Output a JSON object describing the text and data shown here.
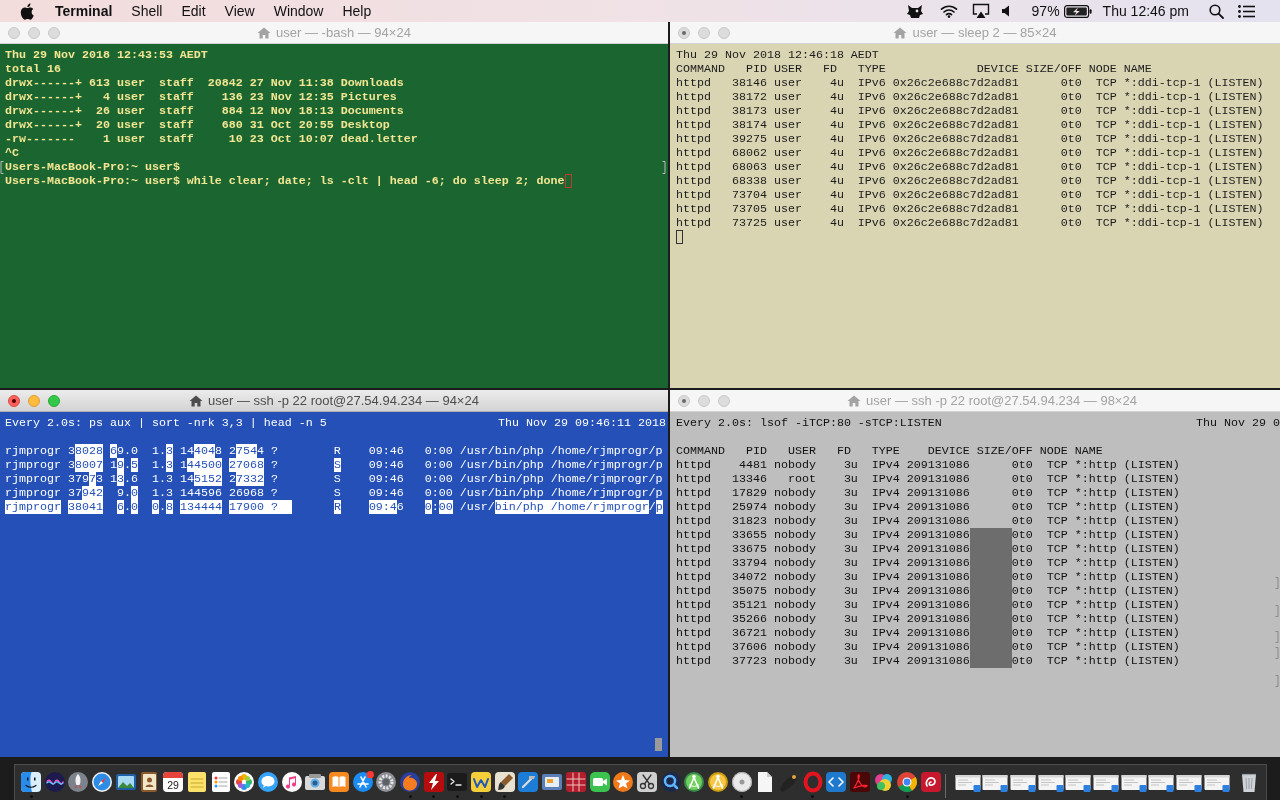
{
  "menu_bar": {
    "app_name": "Terminal",
    "menus": [
      "Shell",
      "Edit",
      "View",
      "Window",
      "Help"
    ],
    "battery_percent": "97%",
    "clock": "Thu 12:46 pm"
  },
  "windows": [
    {
      "kind": "grass",
      "title": "user — -bash — 94×24",
      "active": false,
      "busy": false,
      "cursor": true,
      "lines": [
        {
          "text": "Thu 29 Nov 2018 12:43:53 AEDT",
          "marked": false
        },
        {
          "text": "total 16",
          "marked": false
        },
        {
          "text": "drwx------+ 613 user  staff  20842 27 Nov 11:38 Downloads",
          "marked": false
        },
        {
          "text": "drwx------+   4 user  staff    136 23 Nov 12:35 Pictures",
          "marked": false
        },
        {
          "text": "drwx------+  26 user  staff    884 12 Nov 18:13 Documents",
          "marked": false
        },
        {
          "text": "drwx------+  20 user  staff    680 31 Oct 20:55 Desktop",
          "marked": false
        },
        {
          "text": "-rw-------    1 user  staff     10 23 Oct 10:07 dead.letter",
          "marked": false
        },
        {
          "text": "^C",
          "marked": false
        },
        {
          "text": "Users-MacBook-Pro:~ user$",
          "marked": true
        },
        {
          "text": "Users-MacBook-Pro:~ user$ while clear; date; ls -clt | head -6; do sleep 2; done",
          "marked": false
        }
      ]
    },
    {
      "kind": "novel",
      "title": "user — sleep 2 — 85×24",
      "active": false,
      "busy": true,
      "cursor": true,
      "lines": [
        {
          "text": "Thu 29 Nov 2018 12:46:18 AEDT"
        },
        {
          "text": "COMMAND   PID USER   FD   TYPE             DEVICE SIZE/OFF NODE NAME"
        },
        {
          "text": "httpd   38146 user    4u  IPv6 0x26c2e688c7d2ad81      0t0  TCP *:ddi-tcp-1 (LISTEN)"
        },
        {
          "text": "httpd   38172 user    4u  IPv6 0x26c2e688c7d2ad81      0t0  TCP *:ddi-tcp-1 (LISTEN)"
        },
        {
          "text": "httpd   38173 user    4u  IPv6 0x26c2e688c7d2ad81      0t0  TCP *:ddi-tcp-1 (LISTEN)"
        },
        {
          "text": "httpd   38174 user    4u  IPv6 0x26c2e688c7d2ad81      0t0  TCP *:ddi-tcp-1 (LISTEN)"
        },
        {
          "text": "httpd   39275 user    4u  IPv6 0x26c2e688c7d2ad81      0t0  TCP *:ddi-tcp-1 (LISTEN)"
        },
        {
          "text": "httpd   68062 user    4u  IPv6 0x26c2e688c7d2ad81      0t0  TCP *:ddi-tcp-1 (LISTEN)"
        },
        {
          "text": "httpd   68063 user    4u  IPv6 0x26c2e688c7d2ad81      0t0  TCP *:ddi-tcp-1 (LISTEN)"
        },
        {
          "text": "httpd   68338 user    4u  IPv6 0x26c2e688c7d2ad81      0t0  TCP *:ddi-tcp-1 (LISTEN)"
        },
        {
          "text": "httpd   73704 user    4u  IPv6 0x26c2e688c7d2ad81      0t0  TCP *:ddi-tcp-1 (LISTEN)"
        },
        {
          "text": "httpd   73705 user    4u  IPv6 0x26c2e688c7d2ad81      0t0  TCP *:ddi-tcp-1 (LISTEN)"
        },
        {
          "text": "httpd   73725 user    4u  IPv6 0x26c2e688c7d2ad81      0t0  TCP *:ddi-tcp-1 (LISTEN)"
        }
      ]
    },
    {
      "kind": "ocean",
      "title": "user — ssh -p 22 root@27.54.94.234 — 94×24",
      "active": true,
      "busy": true,
      "cursor": true,
      "header": {
        "command": "Every 2.0s: ps aux | sort -nrk 3,3 | head -n 5",
        "timestamp": "Thu Nov 29 09:46:11 2018"
      },
      "lines": [
        {
          "segments": [
            {
              "text": "rjmprogr 3",
              "highlighted": false
            },
            {
              "text": "8028",
              "highlighted": true
            },
            {
              "text": " 6",
              "highlighted": true
            },
            {
              "text": "9.0  1.",
              "highlighted": false
            },
            {
              "text": "3",
              "highlighted": true
            },
            {
              "text": " 14",
              "highlighted": false
            },
            {
              "text": "404",
              "highlighted": true
            },
            {
              "text": "8 2",
              "highlighted": false
            },
            {
              "text": "754",
              "highlighted": true
            },
            {
              "text": "4 ?        R    09:46   0:00 /usr/bin/php /home/rjmprogr/p",
              "highlighted": false
            }
          ]
        },
        {
          "segments": [
            {
              "text": "rjmprogr 3",
              "highlighted": false
            },
            {
              "text": "8007",
              "highlighted": true
            },
            {
              "text": " 1",
              "highlighted": false
            },
            {
              "text": "9",
              "highlighted": true
            },
            {
              "text": ".",
              "highlighted": false
            },
            {
              "text": "5",
              "highlighted": true
            },
            {
              "text": "  1.",
              "highlighted": false
            },
            {
              "text": "3",
              "highlighted": true
            },
            {
              "text": " 1",
              "highlighted": false
            },
            {
              "text": "44500",
              "highlighted": true
            },
            {
              "text": " 27068",
              "highlighted": true
            },
            {
              "text": " ?        ",
              "highlighted": false
            },
            {
              "text": "S",
              "highlighted": true
            },
            {
              "text": "    09:46   0:00 /usr/bin/php /home/rjmprogr/p",
              "highlighted": false
            }
          ]
        },
        {
          "segments": [
            {
              "text": "rjmprogr 379",
              "highlighted": false
            },
            {
              "text": "7",
              "highlighted": true
            },
            {
              "text": "3 1",
              "highlighted": false
            },
            {
              "text": "3",
              "highlighted": true
            },
            {
              "text": ".6  1.3 14",
              "highlighted": false
            },
            {
              "text": "5152",
              "highlighted": true
            },
            {
              "text": " 2",
              "highlighted": false
            },
            {
              "text": "7332",
              "highlighted": true
            },
            {
              "text": " ?        S    09:46   0:00 /usr/bin/php /home/rjmprogr/p",
              "highlighted": false
            }
          ]
        },
        {
          "segments": [
            {
              "text": "rjmprogr 37",
              "highlighted": false
            },
            {
              "text": "942",
              "highlighted": true
            },
            {
              "text": "  9.",
              "highlighted": false
            },
            {
              "text": "0",
              "highlighted": true
            },
            {
              "text": "  1.3 144596 26968 ?        S    09:46   0:00 /usr/bin/php /home/rjmprogr/p",
              "highlighted": false
            }
          ]
        },
        {
          "segments": [
            {
              "text": "rjmprogr",
              "highlighted": true
            },
            {
              "text": " 38041",
              "highlighted": true
            },
            {
              "text": "  6",
              "highlighted": true
            },
            {
              "text": ".",
              "highlighted": false
            },
            {
              "text": "0",
              "highlighted": true
            },
            {
              "text": "  0",
              "highlighted": true
            },
            {
              "text": ".",
              "highlighted": false
            },
            {
              "text": "8",
              "highlighted": true
            },
            {
              "text": " 134444",
              "highlighted": true
            },
            {
              "text": " 17900 ?  ",
              "highlighted": true
            },
            {
              "text": "      R",
              "highlighted": true
            },
            {
              "text": "    09:4",
              "highlighted": true
            },
            {
              "text": "6",
              "highlighted": false
            },
            {
              "text": "   0",
              "highlighted": true
            },
            {
              "text": ":",
              "highlighted": false
            },
            {
              "text": "00",
              "highlighted": true
            },
            {
              "text": " /usr/",
              "highlighted": false
            },
            {
              "text": "bin/php /home/rjmprogr",
              "highlighted": true
            },
            {
              "text": "/",
              "highlighted": false
            },
            {
              "text": "p",
              "highlighted": true
            }
          ]
        }
      ]
    },
    {
      "kind": "silver",
      "title": "user — ssh -p 22 root@27.54.94.234 — 98×24",
      "active": false,
      "busy": true,
      "header": {
        "command": "Every 2.0s: lsof -iTCP:80 -sTCP:LISTEN",
        "timestamp": "Thu Nov 29 0"
      },
      "lines": [
        {
          "text": "COMMAND   PID   USER   FD   TYPE    DEVICE SIZE/OFF NODE NAME",
          "highlighted": false
        },
        {
          "text": "httpd    4481 nobody    3u  IPv4 209131086      0t0  TCP *:http (LISTEN)",
          "highlighted": false
        },
        {
          "text": "httpd   13346   root    3u  IPv4 209131086      0t0  TCP *:http (LISTEN)",
          "highlighted": false
        },
        {
          "text": "httpd   17829 nobody    3u  IPv4 209131086      0t0  TCP *:http (LISTEN)",
          "highlighted": false
        },
        {
          "text": "httpd   25974 nobody    3u  IPv4 209131086      0t0  TCP *:http (LISTEN)",
          "highlighted": false
        },
        {
          "text": "httpd   31823 nobody    3u  IPv4 209131086      0t0  TCP *:http (LISTEN)",
          "highlighted": false
        },
        {
          "text": "httpd   33655 nobody    3u  IPv4 209131086      0t0  TCP *:http (LISTEN)",
          "highlighted": true
        },
        {
          "text": "httpd   33675 nobody    3u  IPv4 209131086      0t0  TCP *:http (LISTEN)",
          "highlighted": true
        },
        {
          "text": "httpd   33794 nobody    3u  IPv4 209131086      0t0  TCP *:http (LISTEN)",
          "highlighted": true
        },
        {
          "text": "httpd   34072 nobody    3u  IPv4 209131086      0t0  TCP *:http (LISTEN)",
          "highlighted": true
        },
        {
          "text": "httpd   35075 nobody    3u  IPv4 209131086      0t0  TCP *:http (LISTEN)",
          "highlighted": true
        },
        {
          "text": "httpd   35121 nobody    3u  IPv4 209131086      0t0  TCP *:http (LISTEN)",
          "highlighted": true
        },
        {
          "text": "httpd   35266 nobody    3u  IPv4 209131086      0t0  TCP *:http (LISTEN)",
          "highlighted": true
        },
        {
          "text": "httpd   36721 nobody    3u  IPv4 209131086      0t0  TCP *:http (LISTEN)",
          "highlighted": true
        },
        {
          "text": "httpd   37606 nobody    3u  IPv4 209131086      0t0  TCP *:http (LISTEN)",
          "highlighted": true
        },
        {
          "text": "httpd   37723 nobody    3u  IPv4 209131086      0t0  TCP *:http (LISTEN)",
          "highlighted": true
        }
      ]
    }
  ],
  "dock": {
    "apps": [
      {
        "kind": "face",
        "running": true,
        "badge": false
      },
      {
        "kind": "orb",
        "running": false,
        "badge": false
      },
      {
        "kind": "rocket",
        "running": false,
        "badge": false
      },
      {
        "kind": "compass",
        "running": false,
        "badge": false
      },
      {
        "kind": "photo",
        "running": false,
        "badge": false
      },
      {
        "kind": "contacts",
        "running": false,
        "badge": false
      },
      {
        "kind": "calendar",
        "label": "29",
        "running": false,
        "badge": false
      },
      {
        "kind": "note",
        "running": false,
        "badge": false
      },
      {
        "kind": "checklist",
        "running": false,
        "badge": false
      },
      {
        "kind": "flower",
        "running": false,
        "badge": false
      },
      {
        "kind": "chat",
        "running": false,
        "badge": false
      },
      {
        "kind": "music",
        "running": false,
        "badge": false
      },
      {
        "kind": "camera",
        "running": false,
        "badge": false
      },
      {
        "kind": "book",
        "running": false,
        "badge": false
      },
      {
        "kind": "pencils",
        "running": false,
        "badge": true
      },
      {
        "kind": "gear",
        "running": false,
        "badge": false
      },
      {
        "kind": "fox",
        "running": true,
        "badge": false
      },
      {
        "kind": "bolt",
        "running": true,
        "badge": false
      },
      {
        "kind": "terminal",
        "running": true,
        "badge": false
      },
      {
        "kind": "zigzag",
        "running": true,
        "badge": false
      },
      {
        "kind": "paintbrush",
        "running": true,
        "badge": false
      },
      {
        "kind": "hammer",
        "running": false,
        "badge": false
      },
      {
        "kind": "slides",
        "running": false,
        "badge": false
      },
      {
        "kind": "grid",
        "running": false,
        "badge": false
      },
      {
        "kind": "video",
        "running": false,
        "badge": false
      },
      {
        "kind": "star",
        "running": false,
        "badge": false
      },
      {
        "kind": "scissors",
        "running": false,
        "badge": false
      },
      {
        "kind": "lens",
        "running": false,
        "badge": false
      },
      {
        "kind": "studio",
        "running": false,
        "badge": false
      },
      {
        "kind": "canary",
        "running": false,
        "badge": false
      },
      {
        "kind": "disc",
        "running": true,
        "badge": false
      },
      {
        "kind": "document",
        "running": false,
        "badge": false
      },
      {
        "kind": "quill",
        "running": false,
        "badge": false
      },
      {
        "kind": "ring",
        "running": true,
        "badge": false
      },
      {
        "kind": "code",
        "running": false,
        "badge": false
      },
      {
        "kind": "swirl",
        "running": false,
        "badge": false
      },
      {
        "kind": "blob",
        "running": false,
        "badge": false
      },
      {
        "kind": "tricolor",
        "running": true,
        "badge": false
      },
      {
        "kind": "spiral",
        "running": false,
        "badge": false
      }
    ]
  }
}
